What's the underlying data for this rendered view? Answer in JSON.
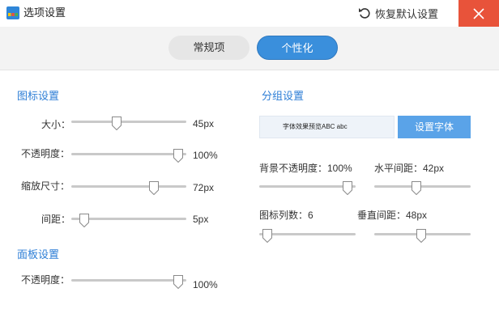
{
  "window": {
    "title": "选项设置",
    "restore_label": "恢复默认设置"
  },
  "tabs": [
    {
      "label": "常规项",
      "active": false
    },
    {
      "label": "个性化",
      "active": true
    }
  ],
  "icon_settings": {
    "title": "图标设置",
    "rows": [
      {
        "label": "大小：",
        "value": "45px",
        "fraction": 0.38
      },
      {
        "label": "不透明度：",
        "value": "100%",
        "fraction": 1.0
      },
      {
        "label": "缩放尺寸：",
        "value": "72px",
        "fraction": 0.75
      },
      {
        "label": "间距：",
        "value": "5px",
        "fraction": 0.05
      }
    ]
  },
  "panel_settings": {
    "title": "面板设置",
    "rows": [
      {
        "label": "不透明度：",
        "value": "100%",
        "fraction": 1.0
      }
    ]
  },
  "group_settings": {
    "title": "分组设置",
    "preview_text": "字体效果预览ABC abc",
    "font_button": "设置字体",
    "bg_opacity": {
      "label": "背景不透明度：100%",
      "fraction": 1.0
    },
    "h_spacing": {
      "label": "水平间距：42px",
      "fraction": 0.42
    },
    "icon_columns": {
      "label": "图标列数：6",
      "fraction": 0.0
    },
    "v_spacing": {
      "label": "垂直间距：48px",
      "fraction": 0.48
    }
  },
  "colors": {
    "accent": "#2d7ed6",
    "tab_active": "#3a8fdc",
    "close_button": "#e8533a",
    "font_button": "#5aa3e8"
  }
}
